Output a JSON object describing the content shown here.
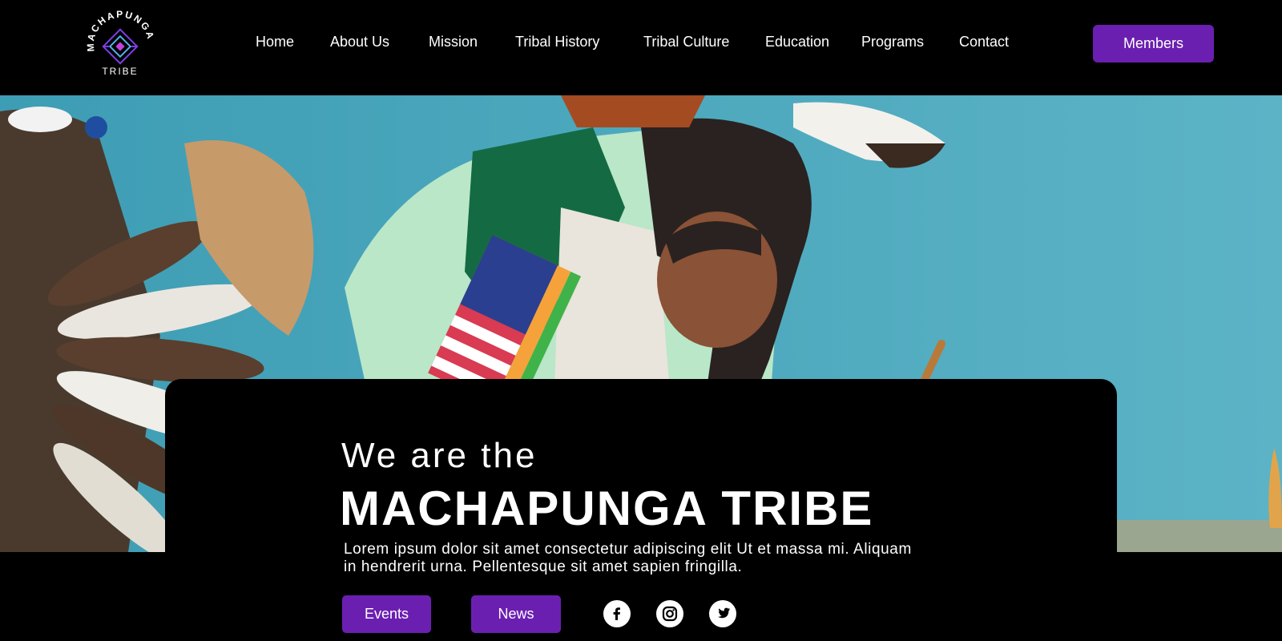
{
  "brand": {
    "logo_arc_text": "MACHAPUNGA",
    "logo_sub_text": "TRIBE"
  },
  "nav": {
    "items": [
      {
        "label": "Home"
      },
      {
        "label": "About Us"
      },
      {
        "label": "Mission"
      },
      {
        "label": "Tribal History"
      },
      {
        "label": "Tribal Culture"
      },
      {
        "label": "Education"
      },
      {
        "label": "Programs"
      },
      {
        "label": "Contact"
      }
    ],
    "members_label": "Members"
  },
  "hero": {
    "intro": "We are the",
    "title": "MACHAPUNGA TRIBE",
    "description": "Lorem ipsum dolor sit amet consectetur adipiscing elit Ut et massa mi. Aliquam in hendrerit urna. Pellentesque sit amet sapien fringilla.",
    "buttons": {
      "events": "Events",
      "news": "News"
    }
  },
  "social": [
    "facebook-icon",
    "instagram-icon",
    "twitter-icon"
  ],
  "colors": {
    "accent": "#6b1fb0",
    "background": "#000000",
    "sky": "#47a3b8",
    "logo_diamond": "#7b3fe4"
  }
}
